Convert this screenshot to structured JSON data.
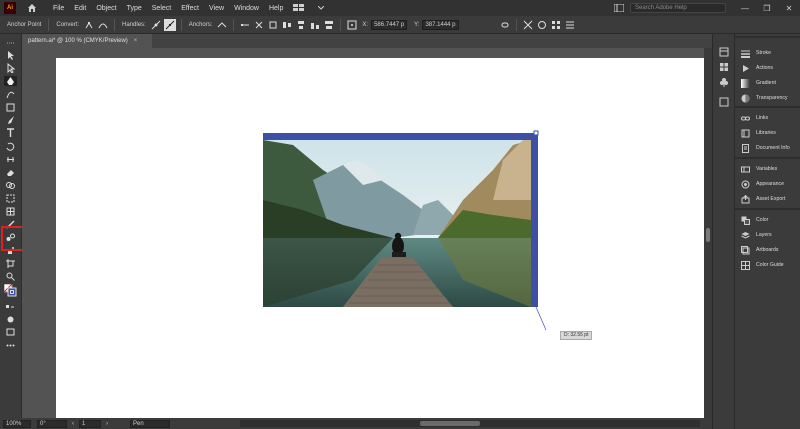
{
  "app": {
    "logo_text": "Ai",
    "menu": [
      "File",
      "Edit",
      "Object",
      "Type",
      "Select",
      "Effect",
      "View",
      "Window",
      "Help"
    ],
    "search_placeholder": "Search Adobe Help"
  },
  "control_bar": {
    "anchor_point_label": "Anchor Point",
    "convert_label": "Convert:",
    "handles_label": "Handles:",
    "anchors_label": "Anchors:",
    "x_value": "586.7447 p",
    "y_value": "387.1444 p"
  },
  "document_tab": {
    "title": "pattern.ai* @ 100 % (CMYK/Preview)",
    "close": "×"
  },
  "canvas": {
    "distance_readout": "D: 32.55 pt"
  },
  "status_bar": {
    "zoom": "100%",
    "rotation": "0°",
    "artboard_number": "1",
    "tool_name": "Pen"
  },
  "panels": [
    {
      "label": "Stroke",
      "icon": "stroke-icon"
    },
    {
      "label": "Actions",
      "icon": "actions-icon"
    },
    {
      "label": "Gradient",
      "icon": "gradient-icon"
    },
    {
      "label": "Transparency",
      "icon": "transparency-icon"
    },
    {
      "label": "Links",
      "icon": "links-icon"
    },
    {
      "label": "Libraries",
      "icon": "libraries-icon"
    },
    {
      "label": "Document Info",
      "icon": "document-info-icon"
    },
    {
      "label": "Variables",
      "icon": "variables-icon"
    },
    {
      "label": "Appearance",
      "icon": "appearance-icon"
    },
    {
      "label": "Asset Export",
      "icon": "asset-export-icon"
    },
    {
      "label": "Color",
      "icon": "color-icon"
    },
    {
      "label": "Layers",
      "icon": "layers-icon"
    },
    {
      "label": "Artboards",
      "icon": "artboards-icon"
    },
    {
      "label": "Color Guide",
      "icon": "color-guide-icon"
    }
  ],
  "colors": {
    "selection": "#3e4fa6",
    "highlight_box": "#e02020",
    "logo_orange": "#ff9a00"
  }
}
